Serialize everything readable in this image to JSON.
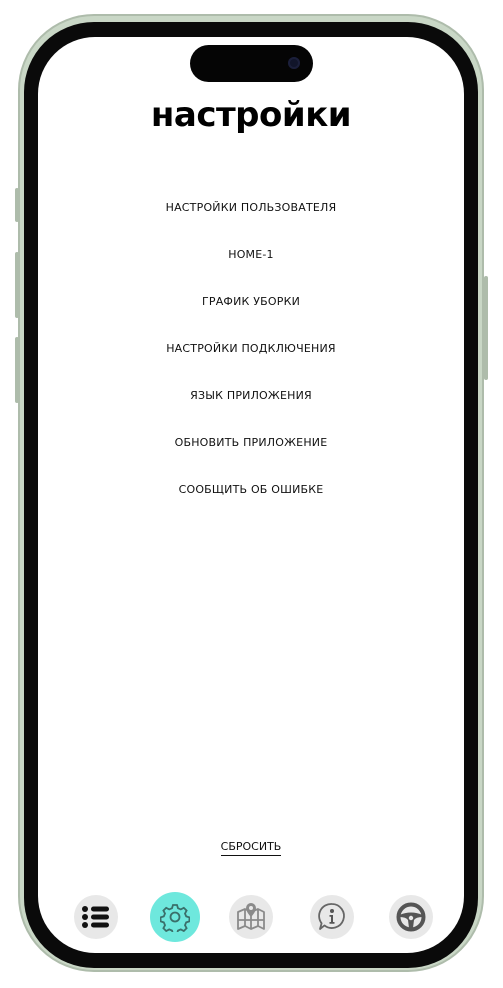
{
  "screen": {
    "title": "настройки"
  },
  "menu": {
    "items": [
      {
        "label": "НАСТРОЙКИ ПОЛЬЗОВАТЕЛЯ"
      },
      {
        "label": "HOME-1"
      },
      {
        "label": "ГРАФИК УБОРКИ"
      },
      {
        "label": "НАСТРОЙКИ ПОДКЛЮЧЕНИЯ"
      },
      {
        "label": "ЯЗЫК ПРИЛОЖЕНИЯ"
      },
      {
        "label": "ОБНОВИТЬ ПРИЛОЖЕНИЕ"
      },
      {
        "label": "СООБЩИТЬ ОБ ОШИБКЕ"
      }
    ]
  },
  "reset": {
    "label": "СБРОСИТЬ"
  },
  "tabbar": {
    "tabs": [
      {
        "icon": "list-icon",
        "active": false
      },
      {
        "icon": "gear-icon",
        "active": true
      },
      {
        "icon": "map-icon",
        "active": false
      },
      {
        "icon": "info-icon",
        "active": false
      },
      {
        "icon": "steering-wheel-icon",
        "active": false
      }
    ],
    "active_color": "#6ee8dd"
  }
}
